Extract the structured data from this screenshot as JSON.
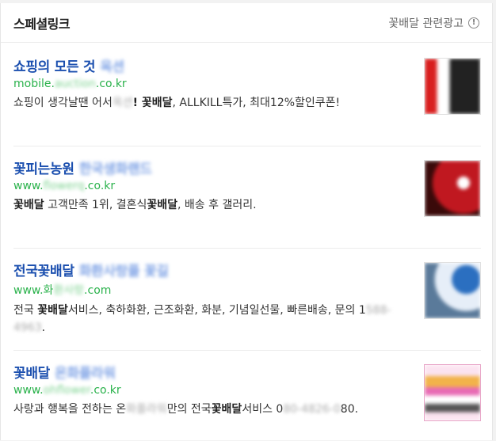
{
  "header": {
    "title": "스페셜링크",
    "related_label": "꽃배달 관련광고",
    "info_symbol": "!"
  },
  "ads": [
    {
      "title": "쇼핑의 모든 것",
      "title_blurred": "옥션",
      "url_prefix": "mobile.",
      "url_blurred": "auction",
      "url_suffix": ".co.kr",
      "desc_parts": [
        "쇼핑이 생각날땐 어서",
        "옥션",
        "! ",
        "꽃배달",
        ", ALLKILL특가, 최대12%할인쿠폰!"
      ],
      "thumb_colors": [
        "#d81e1e",
        "#ffffff"
      ]
    },
    {
      "title": "꽃피는농원",
      "title_blurred": "한국생화랜드",
      "url_prefix": "www.",
      "url_blurred": "flowerq",
      "url_suffix": ".co.kr",
      "desc_parts": [
        "꽃배달",
        " 고객만족 1위, 결혼식",
        "꽃배달",
        ", 배송 후 갤러리."
      ],
      "thumb_colors": [
        "#b8141c",
        "#3a0a0a"
      ]
    },
    {
      "title": "전국꽃배달",
      "title_blurred": "화환사랑플 꽃길",
      "url_prefix": "www.화",
      "url_blurred": "환사랑",
      "url_suffix": ".com",
      "desc_parts": [
        "전국 ",
        "꽃배달",
        "서비스, 축하화환, 근조화환, 화분, 기념일선물, 빠른배송, 문의 1",
        "588-4963",
        "."
      ],
      "thumb_colors": [
        "#4a8cd6",
        "#ffffff"
      ]
    },
    {
      "title": "꽃배달",
      "title_blurred": "온화플라워",
      "url_prefix": "www.",
      "url_blurred": "ohflower",
      "url_suffix": ".co.kr",
      "desc_parts": [
        "사랑과 행복을 전하는 온",
        "화플라워",
        "만의 전국",
        "꽃배달",
        "서비스 0",
        "80-4826-0",
        "80."
      ],
      "thumb_colors": [
        "#e86ab4",
        "#f2d24a"
      ]
    }
  ]
}
